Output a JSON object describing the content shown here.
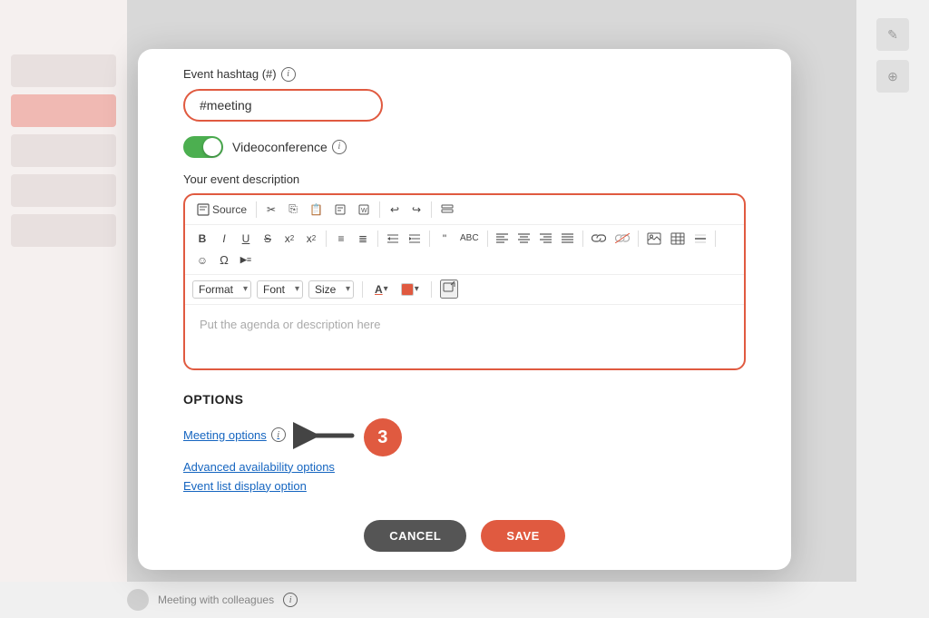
{
  "modal": {
    "hashtag_label": "Event hashtag (#)",
    "hashtag_value": "#meeting",
    "videoconference_label": "Videoconference",
    "description_label": "Your event description",
    "editor_placeholder": "Put the agenda or description here",
    "options_title": "OPTIONS",
    "meeting_options_label": "Meeting options",
    "advanced_availability_label": "Advanced availability options",
    "event_list_label": "Event list display option",
    "cancel_label": "CANCEL",
    "save_label": "SAVE",
    "number_badge": "3"
  },
  "toolbar": {
    "source_label": "Source",
    "format_label": "Format",
    "font_label": "Font",
    "size_label": "Size"
  },
  "bottom": {
    "meeting_text": "Meeting with colleagues"
  }
}
